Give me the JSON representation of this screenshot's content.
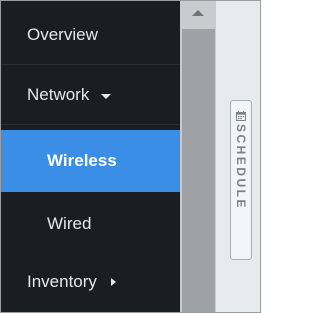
{
  "sidebar": {
    "items": [
      {
        "label": "Overview"
      },
      {
        "label": "Network",
        "caret": "caret-down-icon"
      },
      {
        "label": "Wireless",
        "active": true
      },
      {
        "label": "Wired"
      },
      {
        "label": "Inventory",
        "caret": "caret-right-icon"
      }
    ]
  },
  "right_panel": {
    "schedule_tab": {
      "label": "SCHEDULE",
      "icon": "calendar-icon"
    }
  },
  "colors": {
    "sidebar_bg": "#1a1d22",
    "active_bg": "#3a8ee6",
    "panel_bg": "#e7ebf0",
    "scrollbar": "#9ea2a6"
  }
}
